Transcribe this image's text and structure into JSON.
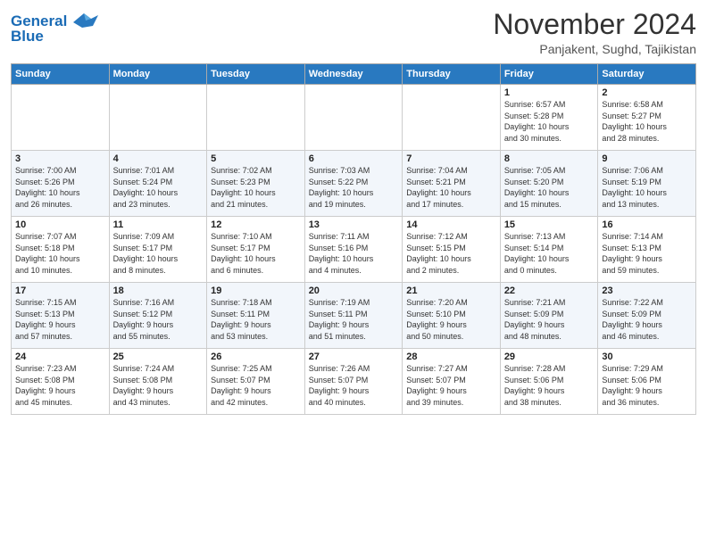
{
  "header": {
    "logo_line1": "General",
    "logo_line2": "Blue",
    "month": "November 2024",
    "location": "Panjakent, Sughd, Tajikistan"
  },
  "days_of_week": [
    "Sunday",
    "Monday",
    "Tuesday",
    "Wednesday",
    "Thursday",
    "Friday",
    "Saturday"
  ],
  "weeks": [
    [
      {
        "day": "",
        "info": ""
      },
      {
        "day": "",
        "info": ""
      },
      {
        "day": "",
        "info": ""
      },
      {
        "day": "",
        "info": ""
      },
      {
        "day": "",
        "info": ""
      },
      {
        "day": "1",
        "info": "Sunrise: 6:57 AM\nSunset: 5:28 PM\nDaylight: 10 hours\nand 30 minutes."
      },
      {
        "day": "2",
        "info": "Sunrise: 6:58 AM\nSunset: 5:27 PM\nDaylight: 10 hours\nand 28 minutes."
      }
    ],
    [
      {
        "day": "3",
        "info": "Sunrise: 7:00 AM\nSunset: 5:26 PM\nDaylight: 10 hours\nand 26 minutes."
      },
      {
        "day": "4",
        "info": "Sunrise: 7:01 AM\nSunset: 5:24 PM\nDaylight: 10 hours\nand 23 minutes."
      },
      {
        "day": "5",
        "info": "Sunrise: 7:02 AM\nSunset: 5:23 PM\nDaylight: 10 hours\nand 21 minutes."
      },
      {
        "day": "6",
        "info": "Sunrise: 7:03 AM\nSunset: 5:22 PM\nDaylight: 10 hours\nand 19 minutes."
      },
      {
        "day": "7",
        "info": "Sunrise: 7:04 AM\nSunset: 5:21 PM\nDaylight: 10 hours\nand 17 minutes."
      },
      {
        "day": "8",
        "info": "Sunrise: 7:05 AM\nSunset: 5:20 PM\nDaylight: 10 hours\nand 15 minutes."
      },
      {
        "day": "9",
        "info": "Sunrise: 7:06 AM\nSunset: 5:19 PM\nDaylight: 10 hours\nand 13 minutes."
      }
    ],
    [
      {
        "day": "10",
        "info": "Sunrise: 7:07 AM\nSunset: 5:18 PM\nDaylight: 10 hours\nand 10 minutes."
      },
      {
        "day": "11",
        "info": "Sunrise: 7:09 AM\nSunset: 5:17 PM\nDaylight: 10 hours\nand 8 minutes."
      },
      {
        "day": "12",
        "info": "Sunrise: 7:10 AM\nSunset: 5:17 PM\nDaylight: 10 hours\nand 6 minutes."
      },
      {
        "day": "13",
        "info": "Sunrise: 7:11 AM\nSunset: 5:16 PM\nDaylight: 10 hours\nand 4 minutes."
      },
      {
        "day": "14",
        "info": "Sunrise: 7:12 AM\nSunset: 5:15 PM\nDaylight: 10 hours\nand 2 minutes."
      },
      {
        "day": "15",
        "info": "Sunrise: 7:13 AM\nSunset: 5:14 PM\nDaylight: 10 hours\nand 0 minutes."
      },
      {
        "day": "16",
        "info": "Sunrise: 7:14 AM\nSunset: 5:13 PM\nDaylight: 9 hours\nand 59 minutes."
      }
    ],
    [
      {
        "day": "17",
        "info": "Sunrise: 7:15 AM\nSunset: 5:13 PM\nDaylight: 9 hours\nand 57 minutes."
      },
      {
        "day": "18",
        "info": "Sunrise: 7:16 AM\nSunset: 5:12 PM\nDaylight: 9 hours\nand 55 minutes."
      },
      {
        "day": "19",
        "info": "Sunrise: 7:18 AM\nSunset: 5:11 PM\nDaylight: 9 hours\nand 53 minutes."
      },
      {
        "day": "20",
        "info": "Sunrise: 7:19 AM\nSunset: 5:11 PM\nDaylight: 9 hours\nand 51 minutes."
      },
      {
        "day": "21",
        "info": "Sunrise: 7:20 AM\nSunset: 5:10 PM\nDaylight: 9 hours\nand 50 minutes."
      },
      {
        "day": "22",
        "info": "Sunrise: 7:21 AM\nSunset: 5:09 PM\nDaylight: 9 hours\nand 48 minutes."
      },
      {
        "day": "23",
        "info": "Sunrise: 7:22 AM\nSunset: 5:09 PM\nDaylight: 9 hours\nand 46 minutes."
      }
    ],
    [
      {
        "day": "24",
        "info": "Sunrise: 7:23 AM\nSunset: 5:08 PM\nDaylight: 9 hours\nand 45 minutes."
      },
      {
        "day": "25",
        "info": "Sunrise: 7:24 AM\nSunset: 5:08 PM\nDaylight: 9 hours\nand 43 minutes."
      },
      {
        "day": "26",
        "info": "Sunrise: 7:25 AM\nSunset: 5:07 PM\nDaylight: 9 hours\nand 42 minutes."
      },
      {
        "day": "27",
        "info": "Sunrise: 7:26 AM\nSunset: 5:07 PM\nDaylight: 9 hours\nand 40 minutes."
      },
      {
        "day": "28",
        "info": "Sunrise: 7:27 AM\nSunset: 5:07 PM\nDaylight: 9 hours\nand 39 minutes."
      },
      {
        "day": "29",
        "info": "Sunrise: 7:28 AM\nSunset: 5:06 PM\nDaylight: 9 hours\nand 38 minutes."
      },
      {
        "day": "30",
        "info": "Sunrise: 7:29 AM\nSunset: 5:06 PM\nDaylight: 9 hours\nand 36 minutes."
      }
    ]
  ]
}
